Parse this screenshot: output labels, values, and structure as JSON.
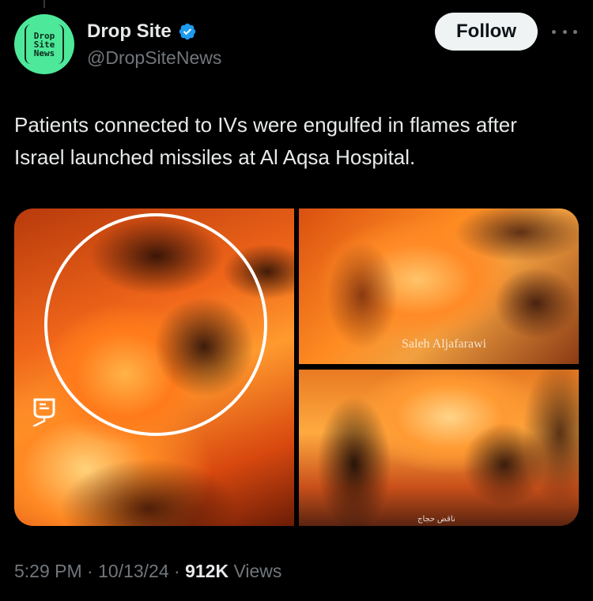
{
  "account": {
    "display_name": "Drop Site",
    "handle": "@DropSiteNews",
    "verified_icon": "verified-badge-icon",
    "avatar_text": [
      "Drop",
      "Site",
      "News"
    ],
    "avatar_color": "#4ee89a",
    "verified_color": "#1d9bf0"
  },
  "actions": {
    "follow_label": "Follow",
    "more_icon": "more-horizontal-icon"
  },
  "post": {
    "text": "Patients connected to IVs were engulfed in flames after Israel launched missiles at Al Aqsa Hospital.",
    "media": {
      "images": [
        {
          "annotation": "circle-highlight"
        },
        {
          "watermark": "Saleh Aljafarawi"
        },
        {
          "caption": "ناقض حجاج"
        }
      ]
    }
  },
  "meta": {
    "time": "5:29 PM",
    "sep1": " · ",
    "date": "10/13/24",
    "sep2": " · ",
    "views_count": "912K",
    "views_label": " Views"
  },
  "colors": {
    "background": "#000000",
    "primary_text": "#e7e9ea",
    "secondary_text": "#71767b",
    "follow_bg": "#eff3f4"
  }
}
